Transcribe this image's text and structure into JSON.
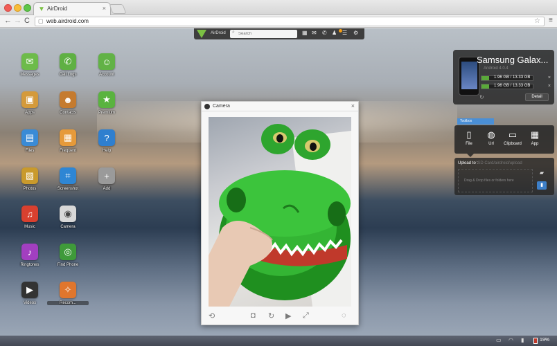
{
  "browser": {
    "tab_title": "AirDroid",
    "tab_close": "×",
    "url": "web.airdroid.com",
    "back": "←",
    "forward": "→",
    "reload": "C",
    "star": "☆",
    "menu": "≡"
  },
  "airdroid_bar": {
    "name": "AirDroid",
    "search_placeholder": "Search"
  },
  "apps": [
    {
      "label": "Messages",
      "icon": "messages-icon",
      "color": "#6dbb4a",
      "glyph": "✉"
    },
    {
      "label": "Call Logs",
      "icon": "call-logs-icon",
      "color": "#5fb043",
      "glyph": "✆"
    },
    {
      "label": "Account",
      "icon": "account-icon",
      "color": "#62b246",
      "glyph": "☺"
    },
    {
      "label": "Apps",
      "icon": "apps-icon",
      "color": "#d49a3b",
      "glyph": "▣"
    },
    {
      "label": "Contacts",
      "icon": "contacts-icon",
      "color": "#c57b2f",
      "glyph": "☻"
    },
    {
      "label": "Premium",
      "icon": "premium-icon",
      "color": "#5ab33f",
      "glyph": "★"
    },
    {
      "label": "Files",
      "icon": "files-icon",
      "color": "#3a8bd6",
      "glyph": "▤"
    },
    {
      "label": "Frequent",
      "icon": "frequent-icon",
      "color": "#e69a3a",
      "glyph": "▦"
    },
    {
      "label": "Help",
      "icon": "help-icon",
      "color": "#2f7fcf",
      "glyph": "?"
    },
    {
      "label": "Photos",
      "icon": "photos-icon",
      "color": "#c99a2c",
      "glyph": "▧"
    },
    {
      "label": "Screenshot",
      "icon": "screenshot-icon",
      "color": "#2e86d4",
      "glyph": "⌗"
    },
    {
      "label": "Add",
      "icon": "add-icon",
      "color": "#9a9a9a",
      "glyph": "+"
    },
    {
      "label": "Music",
      "icon": "music-icon",
      "color": "#d8402f",
      "glyph": "♫"
    },
    {
      "label": "Camera",
      "icon": "camera-icon",
      "color": "#d8d8d8",
      "glyph": "◉"
    },
    {
      "label": "Ringtones",
      "icon": "ringtones-icon",
      "color": "#a23fc0",
      "glyph": "♪"
    },
    {
      "label": "Find Phone",
      "icon": "find-phone-icon",
      "color": "#3f9a3a",
      "glyph": "◎"
    },
    {
      "label": "Videos",
      "icon": "videos-icon",
      "color": "#333333",
      "glyph": "▶"
    },
    {
      "label": "Recom...",
      "icon": "recommend-icon",
      "color": "#e0762d",
      "glyph": "✧"
    }
  ],
  "camera_window": {
    "title": "Camera",
    "close": "×"
  },
  "device": {
    "name": "Samsung Galax...",
    "os": "Android 4.0.4",
    "storage": [
      {
        "text": "1.96 GB / 13.33 GB",
        "fill": 0.15
      },
      {
        "text": "1.96 GB / 13.33 GB",
        "fill": 0.15
      }
    ],
    "detail_label": "Detail"
  },
  "toolbox": {
    "tab_label": "Toolbox",
    "items": [
      {
        "label": "File",
        "icon": "file-icon",
        "glyph": "▯"
      },
      {
        "label": "Url",
        "icon": "url-globe-icon",
        "glyph": "◍"
      },
      {
        "label": "Clipboard",
        "icon": "clipboard-icon",
        "glyph": "▭"
      },
      {
        "label": "App",
        "icon": "app-box-icon",
        "glyph": "▦"
      }
    ]
  },
  "upload": {
    "label": "Upload to :",
    "path": "/ SD Card/airdroid/upload",
    "drop_text": "Drag & Drop files or folders here"
  },
  "statusbar": {
    "battery": "19%"
  }
}
